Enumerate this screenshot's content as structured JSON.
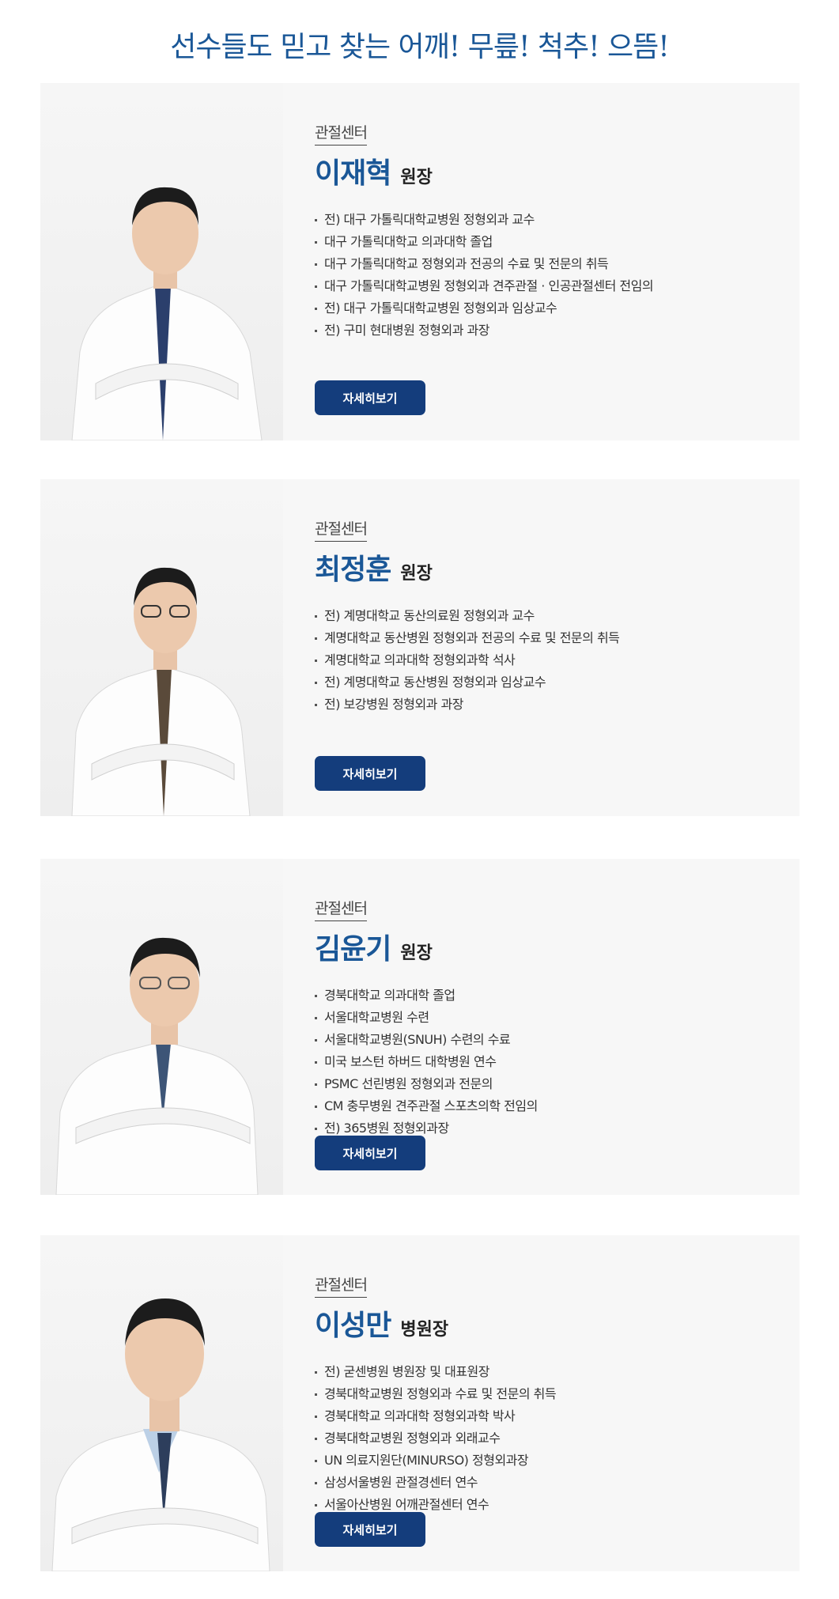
{
  "headline": "선수들도 믿고 찾는 어깨! 무릎! 척추! 으뜸!",
  "doctors": [
    {
      "department": "관절센터",
      "name": "이재혁",
      "title": "원장",
      "career": [
        "전) 대구 가톨릭대학교병원 정형외과 교수",
        "대구 가톨릭대학교 의과대학 졸업",
        "대구 가톨릭대학교 정형외과 전공의 수료 및 전문의 취득",
        "대구 가톨릭대학교병원 정형외과 견주관절 · 인공관절센터 전임의",
        "전) 대구 가톨릭대학교병원 정형외과 임상교수",
        "전) 구미 현대병원 정형외과 과장"
      ],
      "button_label": "자세히보기"
    },
    {
      "department": "관절센터",
      "name": "최정훈",
      "title": "원장",
      "career": [
        "전) 계명대학교 동산의료원 정형외과 교수",
        "계명대학교 동산병원 정형외과 전공의 수료 및 전문의 취득",
        "계명대학교 의과대학 정형외과학 석사",
        "전) 계명대학교 동산병원 정형외과 임상교수",
        "전) 보강병원 정형외과 과장"
      ],
      "button_label": "자세히보기"
    },
    {
      "department": "관절센터",
      "name": "김윤기",
      "title": "원장",
      "career": [
        "경북대학교 의과대학 졸업",
        "서울대학교병원 수련",
        "서울대학교병원(SNUH) 수련의 수료",
        "미국 보스턴 하버드 대학병원 연수",
        "PSMC 선린병원 정형외과 전문의",
        "CM 충무병원 견주관절 스포츠의학 전임의",
        "전) 365병원 정형외과장"
      ],
      "button_label": "자세히보기"
    },
    {
      "department": "관절센터",
      "name": "이성만",
      "title": "병원장",
      "career": [
        "전) 굳센병원 병원장 및 대표원장",
        "경북대학교병원 정형외과 수료 및 전문의 취득",
        "경북대학교 의과대학 정형외과학 박사",
        "경북대학교병원 정형외과 외래교수",
        "UN 의료지원단(MINURSO) 정형외과장",
        "삼성서울병원 관절경센터 연수",
        "서울아산병원 어깨관절센터 연수"
      ],
      "button_label": "자세히보기"
    }
  ]
}
